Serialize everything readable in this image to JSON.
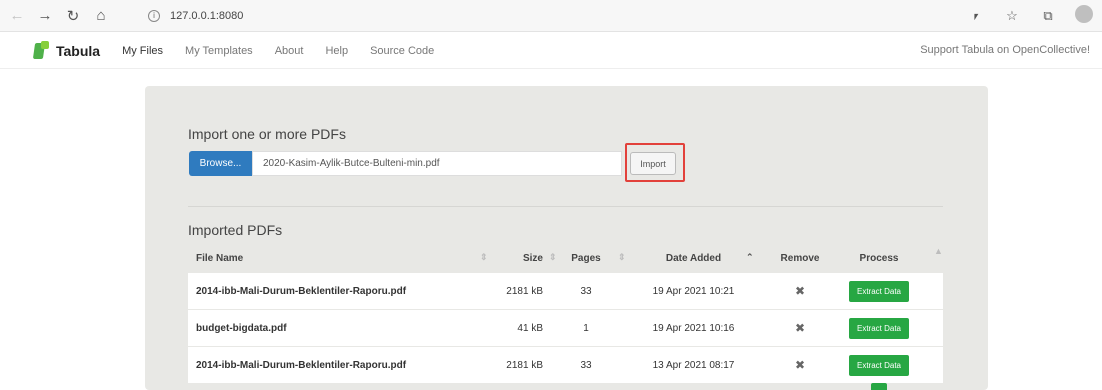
{
  "browser": {
    "url": "127.0.0.1:8080",
    "icons": [
      "back-icon",
      "forward-icon",
      "reload-icon",
      "home-icon",
      "info-icon",
      "reader-icon",
      "favorites-icon",
      "collections-icon",
      "profile-icon"
    ]
  },
  "app": {
    "logo_text": "Tabula",
    "nav": [
      "My Files",
      "My Templates",
      "About",
      "Help",
      "Source Code"
    ],
    "support": "Support Tabula on OpenCollective!"
  },
  "import": {
    "title": "Import one or more PDFs",
    "browse_label": "Browse...",
    "file_value": "2020-Kasim-Aylik-Butce-Bulteni-min.pdf",
    "import_label": "Import"
  },
  "imported": {
    "title": "Imported PDFs",
    "columns": [
      "File Name",
      "Size",
      "Pages",
      "Date Added",
      "Remove",
      "Process"
    ],
    "rows": [
      {
        "name": "2014-ibb-Mali-Durum-Beklentiler-Raporu.pdf",
        "size": "2181 kB",
        "pages": "33",
        "date": "19 Apr 2021 10:21",
        "action": "Extract Data"
      },
      {
        "name": "budget-bigdata.pdf",
        "size": "41 kB",
        "pages": "1",
        "date": "19 Apr 2021 10:16",
        "action": "Extract Data"
      },
      {
        "name": "2014-ibb-Mali-Durum-Beklentiler-Raporu.pdf",
        "size": "2181 kB",
        "pages": "33",
        "date": "13 Apr 2021 08:17",
        "action": "Extract Data"
      }
    ]
  },
  "colors": {
    "browse": "#2f7bbf",
    "extract": "#27a743",
    "highlight": "#e2413b",
    "panel": "#e8e8e5"
  }
}
